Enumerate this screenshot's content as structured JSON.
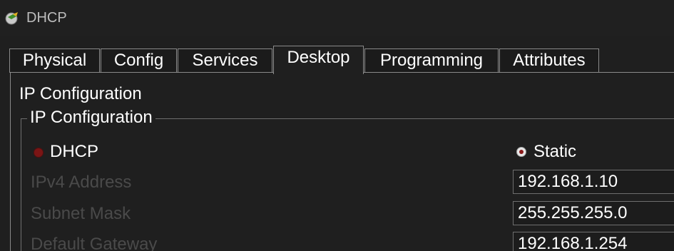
{
  "window": {
    "title": "DHCP",
    "icon": "router-icon"
  },
  "tabs": [
    {
      "label": "Physical",
      "active": false
    },
    {
      "label": "Config",
      "active": false
    },
    {
      "label": "Services",
      "active": false
    },
    {
      "label": "Desktop",
      "active": true
    },
    {
      "label": "Programming",
      "active": false
    },
    {
      "label": "Attributes",
      "active": false
    }
  ],
  "panel": {
    "heading": "IP Configuration",
    "group_title": "IP Configuration",
    "mode_options": {
      "dhcp_label": "DHCP",
      "static_label": "Static",
      "selected": "Static"
    },
    "fields": [
      {
        "label": "IPv4 Address",
        "value": "192.168.1.10"
      },
      {
        "label": "Subnet Mask",
        "value": "255.255.255.0"
      },
      {
        "label": "Default Gateway",
        "value": "192.168.1.254"
      }
    ]
  },
  "colors": {
    "background": "#1f1f1f",
    "border": "#8a8a8a",
    "text": "#ffffff",
    "disabled_text": "#4a4a4a",
    "radio_dhcp": "#7a1515",
    "radio_static_dot": "#8a1a1a"
  }
}
